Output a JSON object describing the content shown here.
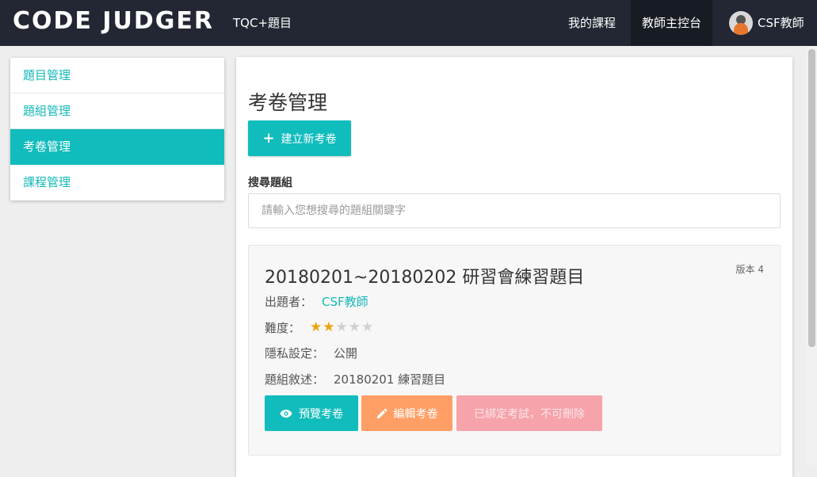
{
  "navbar": {
    "brand": "CODE JUDGER",
    "tqc_link": "TQC+題目",
    "my_courses": "我的課程",
    "dashboard": "教師主控台",
    "user_name": "CSF教師"
  },
  "sidebar": {
    "items": [
      {
        "label": "題目管理"
      },
      {
        "label": "題組管理"
      },
      {
        "label": "考卷管理"
      },
      {
        "label": "課程管理"
      }
    ],
    "active_index": 2
  },
  "main": {
    "title": "考卷管理",
    "new_button_icon": "+",
    "new_button_label": "建立新考卷",
    "search_label": "搜尋題組",
    "search_placeholder": "請輸入您想搜尋的題組關鍵字",
    "card": {
      "title": "20180201~20180202 研習會練習題目",
      "version": "版本 4",
      "author_label": "出題者：",
      "author": "CSF教師",
      "difficulty_label": "難度：",
      "difficulty_rating": 2,
      "difficulty_max": 5,
      "privacy_label": "隱私設定：",
      "privacy": "公開",
      "description_label": "題組敘述：",
      "description": "20180201 練習題目",
      "preview_label": "預覽考卷",
      "edit_label": "編輯考卷",
      "locked_label": "已綁定考試，不可刪除"
    }
  },
  "colors": {
    "navbar": "#222733",
    "accent": "#11bcbc",
    "edit": "#ff9f66",
    "locked": "#f6a3ab",
    "star": "#f0a30a"
  }
}
